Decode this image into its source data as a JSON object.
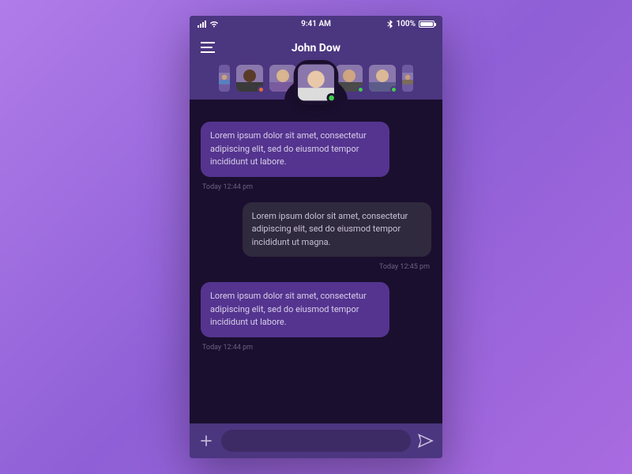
{
  "status_bar": {
    "time": "9:41 AM",
    "battery_text": "100%"
  },
  "header": {
    "title": "John Dow"
  },
  "contacts": [
    {
      "name": "contact-0",
      "status": "none",
      "active": false,
      "skin": "#caa27a",
      "shirt": "#5a7fbf"
    },
    {
      "name": "contact-1",
      "status": "busy",
      "active": false,
      "skin": "#5a3b28",
      "shirt": "#3a3a3a"
    },
    {
      "name": "contact-2",
      "status": "online",
      "active": false,
      "skin": "#d9b590",
      "shirt": "#7a5c9e"
    },
    {
      "name": "contact-3",
      "status": "online",
      "active": true,
      "skin": "#e8c8a8",
      "shirt": "#dcdcdc"
    },
    {
      "name": "contact-4",
      "status": "online",
      "active": false,
      "skin": "#cfa582",
      "shirt": "#4a4a4a"
    },
    {
      "name": "contact-5",
      "status": "online",
      "active": false,
      "skin": "#dbb896",
      "shirt": "#5c5c8a"
    },
    {
      "name": "contact-6",
      "status": "none",
      "active": false,
      "skin": "#c79c78",
      "shirt": "#7a6c5a"
    }
  ],
  "messages": [
    {
      "side": "incoming",
      "text": "Lorem ipsum dolor sit amet, consectetur adipiscing elit, sed do eiusmod tempor incididunt ut labore.",
      "time": "Today 12:44 pm"
    },
    {
      "side": "outgoing",
      "text": "Lorem ipsum dolor sit amet, consectetur adipiscing elit, sed do eiusmod tempor incididunt ut magna.",
      "time": "Today 12:45 pm"
    },
    {
      "side": "incoming",
      "text": "Lorem ipsum dolor sit amet, consectetur adipiscing elit, sed do eiusmod tempor incididunt ut labore.",
      "time": "Today 12:44 pm"
    }
  ],
  "input": {
    "placeholder": ""
  }
}
